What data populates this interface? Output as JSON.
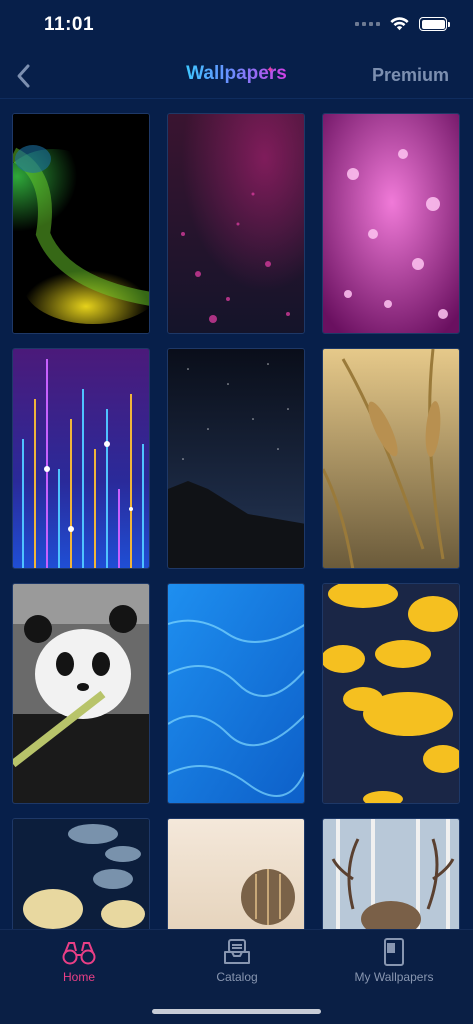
{
  "status": {
    "time": "11:01"
  },
  "nav": {
    "title": "Wallpapers",
    "title_sparkle": "✦",
    "premium_label": "Premium"
  },
  "wallpapers": [
    {
      "subject": "green yellow particle splash on black"
    },
    {
      "subject": "magenta bokeh particles on dark"
    },
    {
      "subject": "pink glowing bokeh lights"
    },
    {
      "subject": "neon light bars on purple"
    },
    {
      "subject": "night sky over mountain"
    },
    {
      "subject": "golden wheat ears"
    },
    {
      "subject": "panda eating bamboo"
    },
    {
      "subject": "blue water caustics"
    },
    {
      "subject": "yellow flowers on dark blue"
    },
    {
      "subject": "jellyfish"
    },
    {
      "subject": "hot air balloon"
    },
    {
      "subject": "deer antlers in birch forest"
    }
  ],
  "tabs": [
    {
      "label": "Home",
      "icon": "binoculars-icon",
      "active": true
    },
    {
      "label": "Catalog",
      "icon": "tray-icon",
      "active": false
    },
    {
      "label": "My Wallpapers",
      "icon": "phone-icon",
      "active": false
    }
  ],
  "colors": {
    "accent": "#ea3f86",
    "background": "#071f4a",
    "tabbar": "#0a1f45",
    "inactive": "#8896b0"
  }
}
